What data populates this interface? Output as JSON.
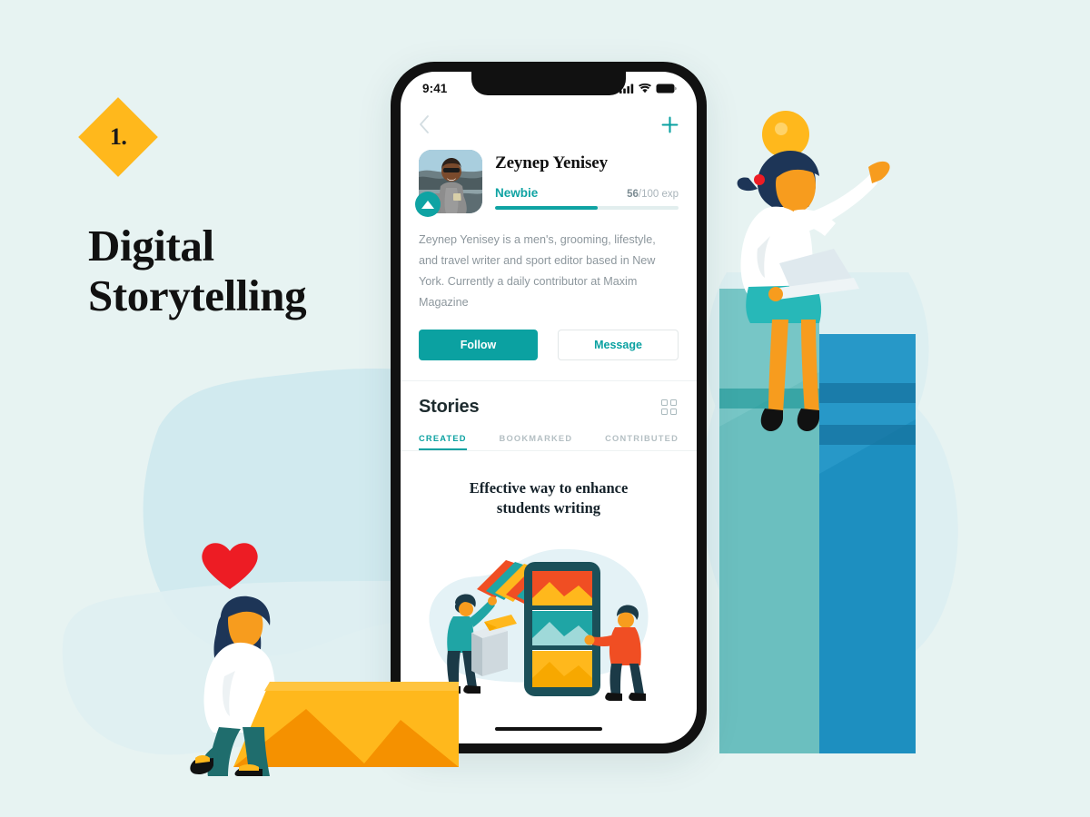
{
  "canvas": {
    "background_color": "#e7f3f2",
    "blob_color": "#cde7ee",
    "blob_color_soft": "#dff0f2"
  },
  "left_panel": {
    "badge_number": "1.",
    "badge_color": "#ffb81c",
    "headline_line1": "Digital",
    "headline_line2": "Storytelling",
    "headline_color": "#111111"
  },
  "phone": {
    "status_bar": {
      "time": "9:41",
      "icons": [
        "signal-icon",
        "wifi-icon",
        "battery-icon"
      ]
    },
    "nav": {
      "back_icon": "chevron-left-icon",
      "add_icon": "plus-icon",
      "accent_color": "#0ba1a1"
    },
    "profile": {
      "avatar_alt": "profile-photo",
      "badge_icon": "triangle-up-icon",
      "name": "Zeynep Yenisey",
      "rank": "Newbie",
      "exp_current": "56",
      "exp_total": "/100 exp",
      "exp_percent": 56,
      "bio": "Zeynep Yenisey is a men's, grooming, lifestyle, and travel writer and sport editor based in New York. Currently a daily contributor at Maxim Magazine"
    },
    "actions": {
      "follow_label": "Follow",
      "message_label": "Message"
    },
    "stories": {
      "title": "Stories",
      "grid_icon": "grid-view-icon",
      "tabs": [
        {
          "label": "CREATED",
          "active": true
        },
        {
          "label": "BOOKMARKED",
          "active": false
        },
        {
          "label": "CONTRIBUTED",
          "active": false
        }
      ],
      "card": {
        "title_line1": "Effective way to enhance",
        "title_line2": "students writing",
        "illustration": "people-arranging-photos-on-phone"
      }
    },
    "home_indicator": "home-indicator-bar"
  },
  "illustrations": {
    "right": {
      "name": "woman-with-idea-on-books",
      "lightbulb_color": "#ffb81c",
      "book_teal": "#6bbfbf",
      "book_blue": "#1d8fc0",
      "skin_color": "#f79c1e",
      "hair_color": "#1d3557"
    },
    "left": {
      "name": "woman-carrying-photo-card",
      "heart_color": "#ed1c24",
      "card_color": "#ffb81c",
      "card_accent": "#f59100",
      "pants_color": "#1f6d6d"
    }
  }
}
